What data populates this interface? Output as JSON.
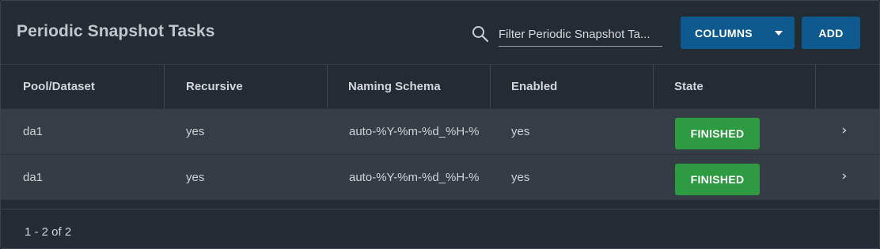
{
  "header": {
    "title": "Periodic Snapshot Tasks",
    "filter_placeholder": "Filter Periodic Snapshot Ta...",
    "columns_button": "COLUMNS",
    "add_button": "ADD"
  },
  "table": {
    "columns": [
      "Pool/Dataset",
      "Recursive",
      "Naming Schema",
      "Enabled",
      "State"
    ],
    "rows": [
      {
        "dataset": "da1",
        "recursive": "yes",
        "naming_schema": "auto-%Y-%m-%d_%H-%",
        "enabled": "yes",
        "state": "FINISHED"
      },
      {
        "dataset": "da1",
        "recursive": "yes",
        "naming_schema": "auto-%Y-%m-%d_%H-%",
        "enabled": "yes",
        "state": "FINISHED"
      }
    ]
  },
  "footer": {
    "paging": "1 - 2 of 2"
  },
  "colors": {
    "primary_button": "#0e5a8e",
    "state_finished": "#2e9b43",
    "background": "#232b35"
  },
  "icons": {
    "search": "search-icon",
    "dropdown": "caret-down-icon",
    "expand": "chevron-right-icon"
  }
}
